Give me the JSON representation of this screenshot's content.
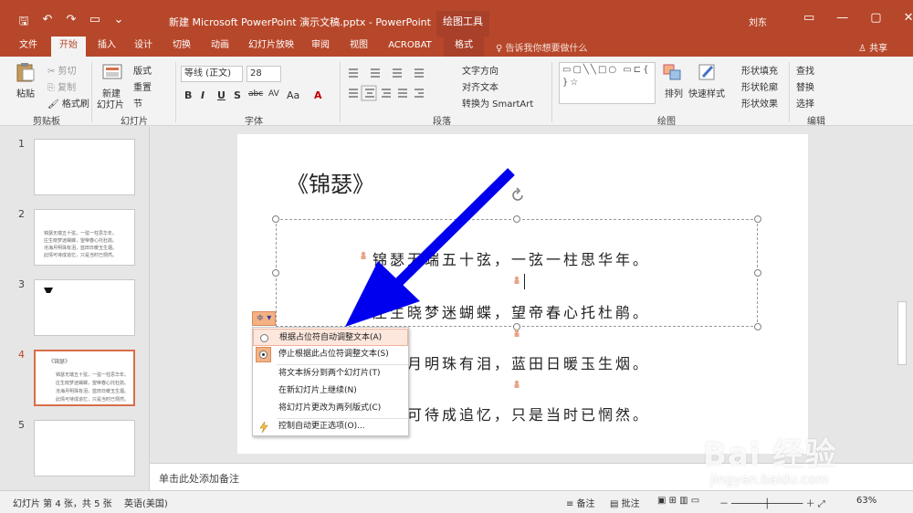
{
  "colors": {
    "brand": "#b7472a",
    "ribbon_bg": "#f3f3f3",
    "active_thumb_border": "#d86e49",
    "arrow": "#0000ee"
  },
  "qat": {
    "icons": [
      "save-icon",
      "undo-icon",
      "redo-icon",
      "present-icon",
      "customize-icon"
    ],
    "glyphs": [
      "🖫",
      "↶",
      "↷",
      "▭",
      "⌄"
    ]
  },
  "title": {
    "doc": "新建 Microsoft PowerPoint 演示文稿.pptx - PowerPoint",
    "context_tools": "绘图工具",
    "user": "刘东"
  },
  "window_controls": [
    "▭",
    "—",
    "▢",
    "✕"
  ],
  "tabs": [
    {
      "label": "文件"
    },
    {
      "label": "开始"
    },
    {
      "label": "插入"
    },
    {
      "label": "设计"
    },
    {
      "label": "切换"
    },
    {
      "label": "动画"
    },
    {
      "label": "幻灯片放映"
    },
    {
      "label": "审阅"
    },
    {
      "label": "视图"
    },
    {
      "label": "ACROBAT"
    },
    {
      "label": "格式"
    }
  ],
  "tell_me": "♀ 告诉我你想要做什么",
  "share": "♙ 共享",
  "ribbon": {
    "clipboard": {
      "paste": "粘贴",
      "cut": "✂ 剪切",
      "copy": "⎘ 复制",
      "format_painter": "🖌 格式刷",
      "label": "剪贴板"
    },
    "slides": {
      "new_slide": "新建",
      "new_slide2": "幻灯片",
      "layout": "版式",
      "reset": "重置",
      "section": "节",
      "label": "幻灯片"
    },
    "font": {
      "name": "等线 (正文)",
      "size": "28",
      "label": "字体",
      "bold": "B",
      "italic": "I",
      "underline": "U",
      "shadow": "S",
      "strike": "abc",
      "spacing": "AV",
      "case": "Aa",
      "color": "A"
    },
    "paragraph": {
      "text_direction": "文字方向",
      "align_text": "对齐文本",
      "smartart": "转换为 SmartArt",
      "label": "段落"
    },
    "drawing": {
      "shapes_glyphs": "▭▢╲╲□○ ▭⊏{ }☆",
      "arrange": "排列",
      "quick_styles": "快速样式",
      "shape_fill": "形状填充",
      "shape_outline": "形状轮廓",
      "shape_effects": "形状效果",
      "label": "绘图"
    },
    "editing": {
      "find": "查找",
      "replace": "替换",
      "select": "选择",
      "label": "编辑"
    }
  },
  "thumbnails": [
    {
      "num": "1",
      "lines": []
    },
    {
      "num": "2",
      "lines": [
        "锦瑟无端五十弦，一弦一柱思华年。",
        "庄生晓梦迷蝴蝶，望帝春心托杜鹃。",
        "沧海月明珠有泪，蓝田日暖玉生烟。",
        "此情可待成追忆，只是当时已惘然。"
      ]
    },
    {
      "num": "3",
      "lines": []
    },
    {
      "num": "4",
      "lines": [
        "《锦瑟》",
        "锦瑟无端五十弦，一弦一柱思华年。",
        "庄生晓梦迷蝴蝶，望帝春心托杜鹃。",
        "沧海月明珠有泪，蓝田日暖玉生烟。",
        "此情可待成追忆，只是当时已惘然。"
      ]
    },
    {
      "num": "5",
      "lines": []
    }
  ],
  "slide": {
    "title": "《锦瑟》",
    "lines": [
      "锦瑟无端五十弦，一弦一柱思华年。",
      "庄生晓梦迷蝴蝶，望帝春心托杜鹃。",
      "沧海月明珠有泪，蓝田日暖玉生烟。",
      "此情可待成追忆，只是当时已惘然。"
    ]
  },
  "autofit_menu": {
    "button_glyph": "≑ ▾",
    "items": [
      {
        "label": "根据占位符自动调整文本(A)",
        "kind": "radio"
      },
      {
        "label": "停止根据此占位符调整文本(S)",
        "kind": "radio-checked"
      },
      {
        "label": "将文本拆分到两个幻灯片(T)",
        "kind": "plain"
      },
      {
        "label": "在新幻灯片上继续(N)",
        "kind": "plain"
      },
      {
        "label": "将幻灯片更改为两列版式(C)",
        "kind": "plain"
      },
      {
        "label": "控制自动更正选项(O)...",
        "kind": "icon"
      }
    ]
  },
  "notes_placeholder": "单击此处添加备注",
  "status": {
    "slide_info": "幻灯片 第 4 张，共 5 张",
    "language": "英语(美国)",
    "notes": "≡ 备注",
    "comments": "▤ 批注",
    "zoom": "63%",
    "view_icons": "▣ ⊞ ▥ ▭",
    "zoom_controls": "－ ──────┼────── ＋ ⤢"
  },
  "watermark": {
    "brand": "Bai 经验",
    "url": "jingyan.baidu.com"
  }
}
